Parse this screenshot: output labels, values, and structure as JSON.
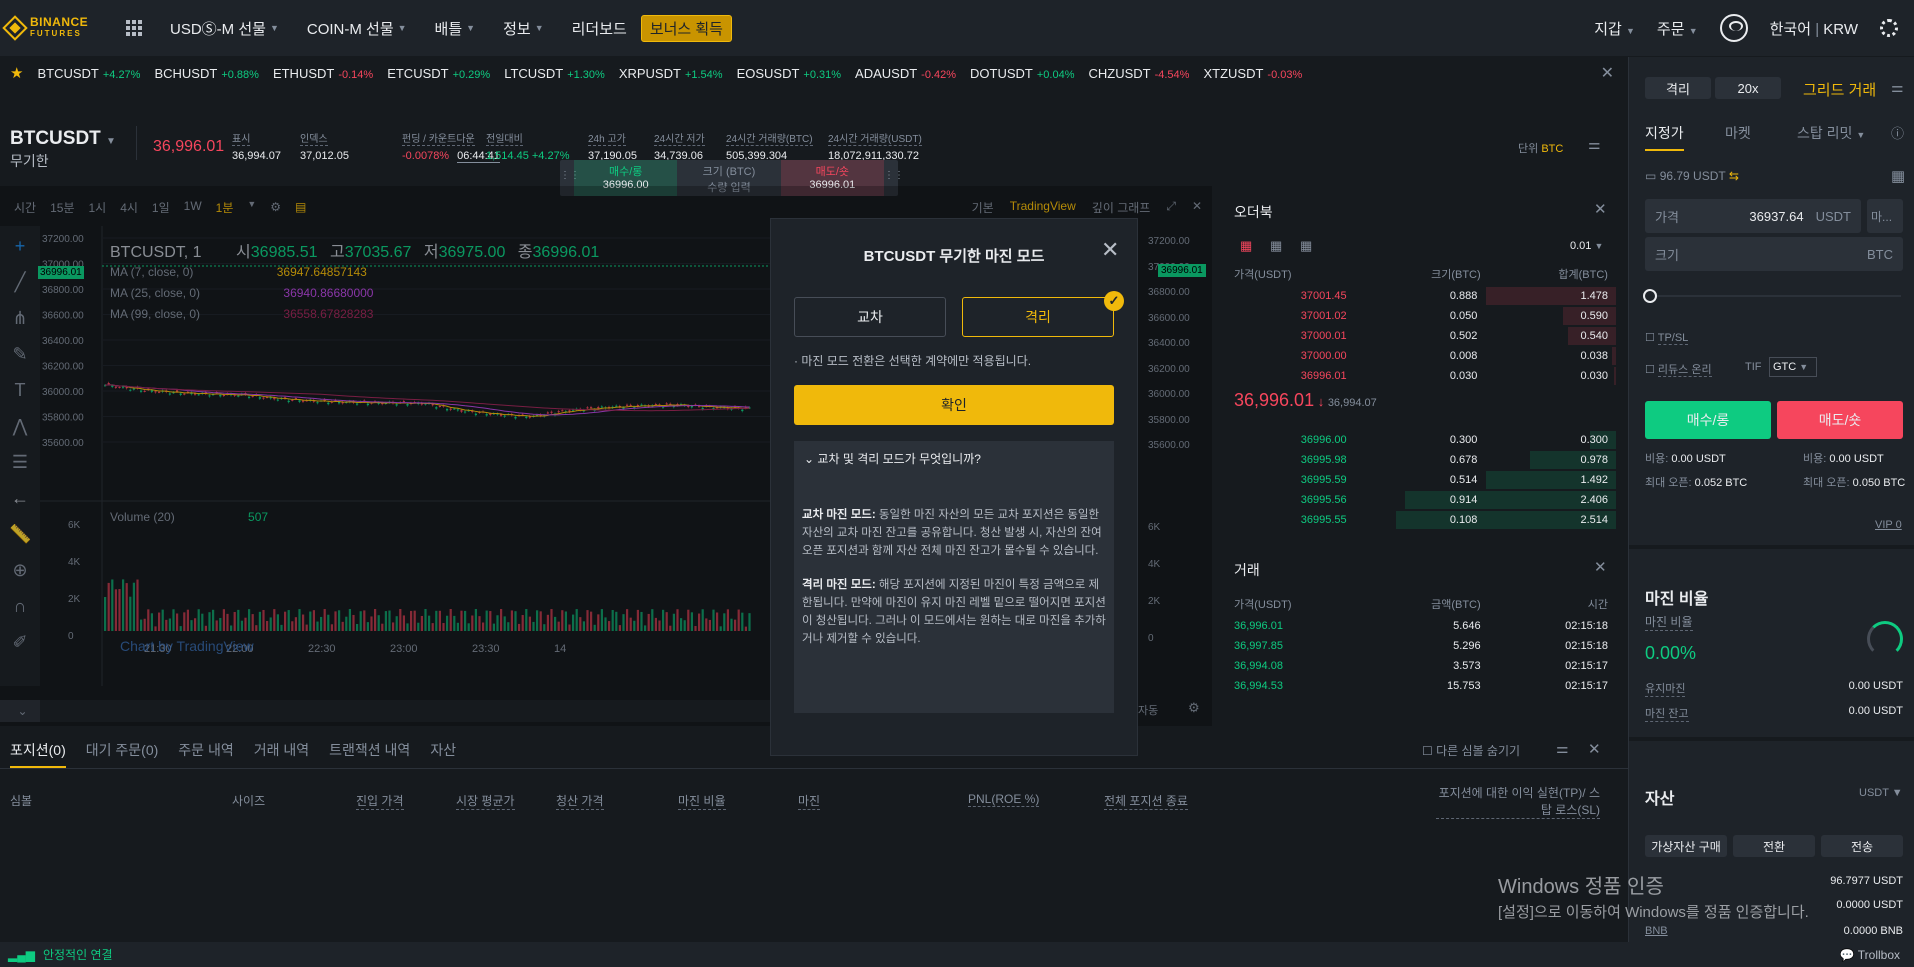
{
  "nav": {
    "logo_line1": "BINANCE",
    "logo_line2": "FUTURES",
    "usdm": "USDⓈ-M 선물",
    "coinm": "COIN-M 선물",
    "battle": "배틀",
    "info": "정보",
    "leaderboard": "리더보드",
    "bonus": "보너스 획득",
    "wallet": "지갑",
    "orders": "주문",
    "lang": "한국어",
    "currency": "KRW"
  },
  "ticker": [
    {
      "s": "BTCUSDT",
      "c": "+4.27%",
      "d": "up"
    },
    {
      "s": "BCHUSDT",
      "c": "+0.88%",
      "d": "up"
    },
    {
      "s": "ETHUSDT",
      "c": "-0.14%",
      "d": "dn"
    },
    {
      "s": "ETCUSDT",
      "c": "+0.29%",
      "d": "up"
    },
    {
      "s": "LTCUSDT",
      "c": "+1.30%",
      "d": "up"
    },
    {
      "s": "XRPUSDT",
      "c": "+1.54%",
      "d": "up"
    },
    {
      "s": "EOSUSDT",
      "c": "+0.31%",
      "d": "up"
    },
    {
      "s": "ADAUSDT",
      "c": "-0.42%",
      "d": "dn"
    },
    {
      "s": "DOTUSDT",
      "c": "+0.04%",
      "d": "up"
    },
    {
      "s": "CHZUSDT",
      "c": "-4.54%",
      "d": "dn"
    },
    {
      "s": "XTZUSDT",
      "c": "-0.03%",
      "d": "dn"
    }
  ],
  "symbol": {
    "name": "BTCUSDT",
    "sub": "무기한",
    "price": "36,996.01",
    "stats": [
      {
        "l": "표시",
        "v": "36,994.07"
      },
      {
        "l": "인덱스",
        "v": "37,012.05"
      },
      {
        "l": "펀딩 / 카운트다운",
        "v": "-0.0078%",
        "v2": "06:44:41"
      },
      {
        "l": "전일대비",
        "v": "1,514.45 +4.27%"
      },
      {
        "l": "24h 고가",
        "v": "37,190.05"
      },
      {
        "l": "24시간 저가",
        "v": "34,739.06"
      },
      {
        "l": "24시간 거래량(BTC)",
        "v": "505,399.304"
      },
      {
        "l": "24시간 거래량(USDT)",
        "v": "18,072,911,330.72"
      }
    ],
    "unit_label": "단위",
    "unit": "BTC",
    "buy_label": "매수/롱",
    "buy_val": "36996.00",
    "size_label": "크기 (BTC)",
    "size_ph": "수량 입력",
    "sell_label": "매도/숏",
    "sell_val": "36996.01"
  },
  "charttools": {
    "intervals": [
      "시간",
      "15분",
      "1시",
      "4시",
      "1일",
      "1W",
      "1분"
    ],
    "views": [
      "기본",
      "TradingView",
      "깊이 그래프"
    ]
  },
  "chart": {
    "title": "BTCUSDT, 1",
    "o": "36985.51",
    "h": "37035.67",
    "l": "36975.00",
    "c": "36996.01",
    "o_l": "시",
    "h_l": "고",
    "l_l": "저",
    "c_l": "종",
    "ma7": "MA (7, close, 0)",
    "ma7v": "36947.64857143",
    "ma25": "MA (25, close, 0)",
    "ma25v": "36940.86680000",
    "ma99": "MA (99, close, 0)",
    "ma99v": "36558.67828283",
    "vol": "Volume (20)",
    "volv": "507",
    "watermark": "Chart by TradingView",
    "price_tag": "36996.01",
    "y_ticks": [
      "37200.00",
      "37000.00",
      "36800.00",
      "36600.00",
      "36400.00",
      "36200.00",
      "36000.00",
      "35800.00",
      "35600.00"
    ],
    "vol_ticks": [
      "6K",
      "4K",
      "2K",
      "0"
    ],
    "x_ticks": [
      "21:30",
      "22:00",
      "22:30",
      "23:00",
      "23:30",
      "14"
    ],
    "auto": "자동"
  },
  "modal": {
    "title": "BTCUSDT 무기한 마진 모드",
    "cross": "교차",
    "isolated": "격리",
    "note": "· 마진 모드 전환은 선택한 계약에만 적용됩니다.",
    "confirm": "확인",
    "faq_title": "교차 및 격리 모드가 무엇입니까?",
    "cross_title": "교차 마진 모드:",
    "cross_text": "동일한 마진 자산의 모든 교차 포지션은 동일한 자산의 교차 마진 잔고를 공유합니다. 청산 발생 시, 자산의 잔여 오픈 포지션과 함께 자산 전체 마진 잔고가 몰수될 수 있습니다.",
    "iso_title": "격리 마진 모드:",
    "iso_text": "해당 포지션에 지정된 마진이 특정 금액으로 제한됩니다. 만약에 마진이 유지 마진 레벨 밑으로 떨어지면 포지션이 청산됩니다. 그러나 이 모드에서는 원하는 대로 마진을 추가하거나 제거할 수 있습니다."
  },
  "orderbook": {
    "title": "오더북",
    "precision": "0.01",
    "h_price": "가격(USDT)",
    "h_size": "크기(BTC)",
    "h_sum": "합계(BTC)",
    "asks": [
      [
        "37001.45",
        "0.888",
        "1.478"
      ],
      [
        "37001.02",
        "0.050",
        "0.590"
      ],
      [
        "37000.01",
        "0.502",
        "0.540"
      ],
      [
        "37000.00",
        "0.008",
        "0.038"
      ],
      [
        "36996.01",
        "0.030",
        "0.030"
      ]
    ],
    "ask_depth": [
      0.59,
      0.24,
      0.22,
      0.02,
      0.01
    ],
    "mid": "36,996.01",
    "mid_mark": "36,994.07",
    "bids": [
      [
        "36996.00",
        "0.300",
        "0.300"
      ],
      [
        "36995.98",
        "0.678",
        "0.978"
      ],
      [
        "36995.59",
        "0.514",
        "1.492"
      ],
      [
        "36995.56",
        "0.914",
        "2.406"
      ],
      [
        "36995.55",
        "0.108",
        "2.514"
      ]
    ],
    "bid_depth": [
      0.12,
      0.39,
      0.59,
      0.96,
      1.0
    ]
  },
  "trades": {
    "title": "거래",
    "h_price": "가격(USDT)",
    "h_amt": "금액(BTC)",
    "h_time": "시간",
    "rows": [
      [
        "36,996.01",
        "5.646",
        "02:15:18"
      ],
      [
        "36,997.85",
        "5.296",
        "02:15:18"
      ],
      [
        "36,994.08",
        "3.573",
        "02:15:17"
      ],
      [
        "36,994.53",
        "15.753",
        "02:15:17"
      ]
    ]
  },
  "right": {
    "isolated": "격리",
    "leverage": "20x",
    "grid": "그리드 거래",
    "tabs": [
      "지정가",
      "마켓",
      "스탑 리밋"
    ],
    "balance": "96.79 USDT",
    "price_label": "가격",
    "price_val": "36937.64",
    "price_unit": "USDT",
    "mkt": "마...",
    "size_label": "크기",
    "size_unit": "BTC",
    "tpsl": "TP/SL",
    "reduce": "리듀스 온리",
    "tif": "TIF",
    "gtc": "GTC",
    "buy": "매수/롱",
    "sell": "매도/숏",
    "cost_l": "비용:",
    "cost_buy": "0.00 USDT",
    "cost_sell": "0.00 USDT",
    "max_l": "최대 오픈:",
    "max_buy": "0.052 BTC",
    "max_sell": "0.050 BTC",
    "vip": "VIP 0",
    "margin_ratio_title": "마진 비율",
    "margin_ratio_l": "마진 비율",
    "margin_ratio": "0.00%",
    "maint_l": "유지마진",
    "maint": "0.00 USDT",
    "bal_l": "마진 잔고",
    "bal": "0.00 USDT",
    "assets_title": "자산",
    "assets_unit": "USDT",
    "buy_crypto": "가상자산 구매",
    "convert": "전환",
    "transfer": "전송",
    "wallet_bal": "96.7977 USDT",
    "unreal": "0.0000 USDT",
    "bnb_l": "BNB",
    "bnb": "0.0000 BNB"
  },
  "bottom": {
    "tabs": [
      "포지션(0)",
      "대기 주문(0)",
      "주문 내역",
      "거래 내역",
      "트랜잭션 내역",
      "자산"
    ],
    "hide_other": "다른 심볼 숨기기",
    "cols": [
      "심볼",
      "사이즈",
      "진입 가격",
      "시장 평균가",
      "청산 가격",
      "마진 비율",
      "마진",
      "PNL(ROE %)",
      "전체 포지션 종료"
    ],
    "tpsl_col": "포지션에 대한 이익 실현(TP)/ 스탑 로스(SL)"
  },
  "status": {
    "conn": "안정적인 연결",
    "trollbox": "Trollbox"
  },
  "windows": {
    "title": "Windows 정품 인증",
    "sub": "[설정]으로 이동하여 Windows를 정품 인증합니다."
  },
  "colors": {
    "accent": "#f0b90b",
    "up": "#0ecb81",
    "down": "#f6465d",
    "bg": "#161a1e",
    "panel": "#1e2329"
  }
}
